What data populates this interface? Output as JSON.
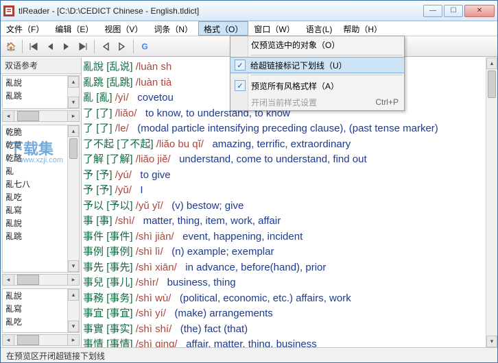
{
  "title": "tlReader - [C:\\D:\\CEDICT Chinese - English.tldict]",
  "menubar": {
    "items": [
      {
        "label": "文件（F）"
      },
      {
        "label": "编辑（E）"
      },
      {
        "label": "视图（V）"
      },
      {
        "label": "词条（N）"
      },
      {
        "label": "格式（O）"
      },
      {
        "label": "窗口（W）"
      },
      {
        "label": "语言(L)"
      },
      {
        "label": "帮助（H）"
      }
    ]
  },
  "dropdown": {
    "items": [
      {
        "label": "仅预览选中的对象（O）",
        "checked": false
      },
      {
        "label": "给超链接标记下划线（U）",
        "checked": true,
        "selected": true
      },
      {
        "label": "预览所有风格式样（A）",
        "checked": true
      },
      {
        "label": "开闭当前样式设置",
        "disabled": true,
        "shortcut": "Ctrl+P"
      }
    ]
  },
  "sidebar": {
    "header": "双语参考",
    "pane1": [
      "亂說",
      "亂跳"
    ],
    "pane2": [
      "乾脆",
      "乾草",
      "乾酪",
      "亂",
      "亂七八",
      "亂吃",
      "亂寫",
      "亂說",
      "亂跳"
    ],
    "pane3": [
      "亂說",
      "亂寫",
      "亂吃"
    ]
  },
  "entries": [
    {
      "trad": "亂說",
      "simp": "乱说",
      "py": "/luàn sh",
      "gloss": ""
    },
    {
      "trad": "亂跳",
      "simp": "乱跳",
      "py": "/luàn tià",
      "gloss": ""
    },
    {
      "trad": "亂",
      "simp": "亂",
      "py": "/yì/",
      "gloss": "covetou"
    },
    {
      "trad": "了",
      "simp": "了",
      "py": "/liăo/",
      "gloss": "to know, to understand, to know"
    },
    {
      "trad": "了",
      "simp": "了",
      "py": "/le/",
      "gloss": "(modal particle intensifying preceding clause), (past tense marker)"
    },
    {
      "trad": "了不起",
      "simp": "了不起",
      "py": "/liăo bu qĭ/",
      "gloss": "amazing, terrific, extraordinary"
    },
    {
      "trad": "了解",
      "simp": "了解",
      "py": "/liăo jiĕ/",
      "gloss": "understand, come to understand, find out"
    },
    {
      "trad": "予",
      "simp": "予",
      "py": "/yú/",
      "gloss": "to give"
    },
    {
      "trad": "予",
      "simp": "予",
      "py": "/yŭ/",
      "gloss": "I"
    },
    {
      "trad": "予以",
      "simp": "予以",
      "py": "/yŭ yĭ/",
      "gloss": "(v) bestow; give"
    },
    {
      "trad": "事",
      "simp": "事",
      "py": "/shì/",
      "gloss": "matter, thing, item, work, affair"
    },
    {
      "trad": "事件",
      "simp": "事件",
      "py": "/shì jiàn/",
      "gloss": "event, happening, incident"
    },
    {
      "trad": "事例",
      "simp": "事例",
      "py": "/shì lì/",
      "gloss": "(n) example; exemplar"
    },
    {
      "trad": "事先",
      "simp": "事先",
      "py": "/shì xiān/",
      "gloss": "in advance, before(hand), prior"
    },
    {
      "trad": "事兒",
      "simp": "事儿",
      "py": "/shìr/",
      "gloss": "business, thing"
    },
    {
      "trad": "事務",
      "simp": "事务",
      "py": "/shì wù/",
      "gloss": "(political, economic, etc.) affairs, work"
    },
    {
      "trad": "事宜",
      "simp": "事宜",
      "py": "/shì yí/",
      "gloss": "(make) arrangements"
    },
    {
      "trad": "事實",
      "simp": "事实",
      "py": "/shì shí/",
      "gloss": "(the) fact (that)"
    },
    {
      "trad": "事情",
      "simp": "事情",
      "py": "/shì qing/",
      "gloss": "affair, matter, thing, business"
    }
  ],
  "statusbar": "在预览区开闭超链接下划线",
  "watermark": {
    "big": "下载集",
    "small": "www.xzji.com"
  }
}
